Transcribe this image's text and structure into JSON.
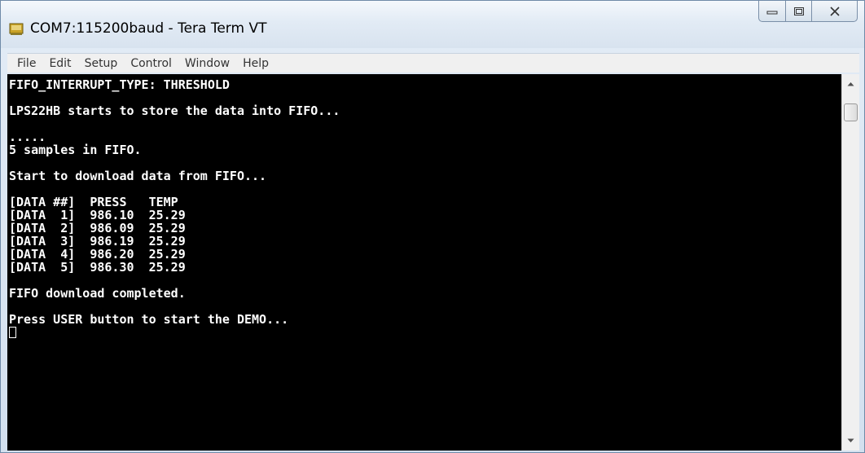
{
  "window": {
    "title": "COM7:115200baud - Tera Term VT",
    "app_icon": "tera-term-icon",
    "controls": [
      "minimize-icon",
      "maximize-icon",
      "close-icon"
    ]
  },
  "menu": {
    "items": [
      "File",
      "Edit",
      "Setup",
      "Control",
      "Window",
      "Help"
    ]
  },
  "terminal": {
    "lines": [
      "FIFO_INTERRUPT_TYPE: THRESHOLD",
      "",
      "LPS22HB starts to store the data into FIFO...",
      "",
      ".....",
      "5 samples in FIFO.",
      "",
      "Start to download data from FIFO...",
      "",
      "[DATA ##]  PRESS   TEMP",
      "[DATA  1]  986.10  25.29",
      "[DATA  2]  986.09  25.29",
      "[DATA  3]  986.19  25.29",
      "[DATA  4]  986.20  25.29",
      "[DATA  5]  986.30  25.29",
      "",
      "FIFO download completed.",
      "",
      "Press USER button to start the DEMO...",
      ""
    ],
    "background": "#000000",
    "foreground": "#ffffff"
  },
  "scrollbar": {
    "up_icon": "scroll-up-arrow-icon",
    "down_icon": "scroll-down-arrow-icon"
  }
}
